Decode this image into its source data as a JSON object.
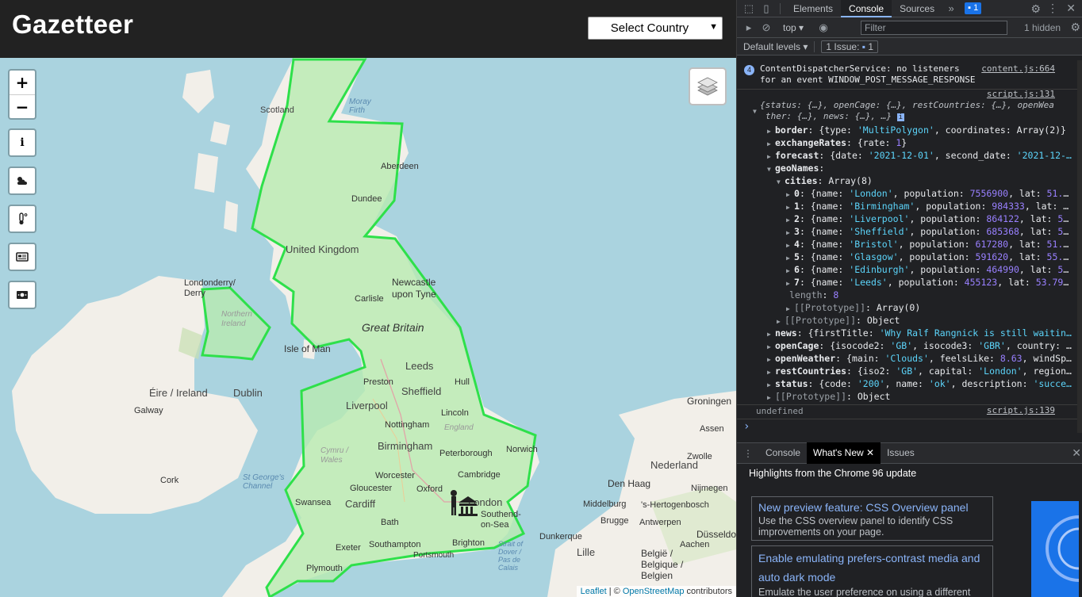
{
  "app": {
    "title": "Gazetteer",
    "country_select": "Select Country"
  },
  "map": {
    "controls": {
      "zoom_in": "+",
      "zoom_out": "−",
      "info": "i"
    },
    "labels": {
      "scotland": "Scotland",
      "moray_firth": "Moray Firth",
      "aberdeen": "Aberdeen",
      "dundee": "Dundee",
      "united_kingdom": "United Kingdom",
      "newcastle": "Newcastle upon Tyne",
      "carlisle": "Carlisle",
      "great_britain": "Great Britain",
      "isle_of_man": "Isle of Man",
      "londonderry": "Londonderry/ Derry",
      "northern_ireland": "Northern Ireland",
      "eire": "Éire / Ireland",
      "dublin": "Dublin",
      "galway": "Galway",
      "cork": "Cork",
      "st_georges": "St George's Channel",
      "leeds": "Leeds",
      "preston": "Preston",
      "shetfield": "Sheffield",
      "hull": "Hull",
      "liverpool": "Liverpool",
      "lincoln": "Lincoln",
      "nottingham": "Nottingham",
      "england": "England",
      "cymru": "Cymru / Wales",
      "birmingham": "Birmingham",
      "peterborough": "Peterborough",
      "norwich": "Norwich",
      "worcester": "Worcester",
      "cambridge": "Cambridge",
      "gloucester": "Gloucester",
      "oxford": "Oxford",
      "swansea": "Swansea",
      "cardiff": "Cardiff",
      "london": "London",
      "southend": "Southend-on-Sea",
      "bath": "Bath",
      "southampton": "Southampton",
      "brighton": "Brighton",
      "exeter": "Exeter",
      "portsmouth": "Portsmouth",
      "plymouth": "Plymouth",
      "groningen": "Groningen",
      "assen": "Assen",
      "zwolle": "Zwolle",
      "nederland": "Nederland",
      "den_haag": "Den Haag",
      "nijmegen": "Nijmegen",
      "middelburg": "Middelburg",
      "hertogenbosch": "'s-Hertogenbosch",
      "brugge": "Brugge",
      "antwerpen": "Antwerpen",
      "duisseldorf": "Düsseldorf",
      "dunkerque": "Dunkerque",
      "lille": "Lille",
      "belgie": "België / Belgique / Belgien",
      "aachen": "Aachen",
      "dover": "Strait of Dover / Pas de Calais"
    },
    "attribution": {
      "leaflet": "Leaflet",
      "sep": " | © ",
      "osm": "OpenStreetMap",
      "contrib": " contributors"
    },
    "colors": {
      "sea": "#aad3df",
      "land": "#f2efe9",
      "border_highlight": "#2ee04a",
      "highlight_fill": "#b8ebb0"
    }
  },
  "devtools": {
    "tabs": [
      "Elements",
      "Console",
      "Sources"
    ],
    "active_tab": "Console",
    "issue_count": "1",
    "context": "top",
    "filter_placeholder": "Filter",
    "hidden": "1 hidden",
    "default_levels": "Default levels",
    "issues_badge": "1 Issue:",
    "issues_badge_count": "1",
    "messages": {
      "warn_count": "4",
      "warn_line1": "ContentDispatcherService: no listeners",
      "warn_line2": "for an event WINDOW_POST_MESSAGE_RESPONSE",
      "warn_src": "content.js:664",
      "log_src": "script.js:131",
      "obj_line1": "{status: {…}, openCage: {…}, restCountries: {…}, openWea",
      "obj_line2": "ther: {…}, news: {…}, …}",
      "undefined": "undefined",
      "undef_src": "script.js:139",
      "prompt": "›"
    },
    "tree": [
      {
        "key": "border",
        "val": "{type: 'MultiPolygon', coordinates: Array(2)}",
        "indent": 0
      },
      {
        "key": "exchangeRates",
        "val": "{rate: 1}",
        "indent": 0
      },
      {
        "key": "forecast",
        "val": "{date: '2021-12-01', second_date: '2021-12-…",
        "indent": 0
      },
      {
        "key": "geoNames",
        "val": "",
        "indent": 0,
        "open": true
      },
      {
        "key": "cities",
        "val": "Array(8)",
        "indent": 1,
        "open": true
      },
      {
        "key": "0",
        "val": "{name: 'London', population: 7556900, lat: 51.…",
        "indent": 2
      },
      {
        "key": "1",
        "val": "{name: 'Birmingham', population: 984333, lat: …",
        "indent": 2
      },
      {
        "key": "2",
        "val": "{name: 'Liverpool', population: 864122, lat: 5…",
        "indent": 2
      },
      {
        "key": "3",
        "val": "{name: 'Sheffield', population: 685368, lat: 5…",
        "indent": 2
      },
      {
        "key": "4",
        "val": "{name: 'Bristol', population: 617280, lat: 51.…",
        "indent": 2
      },
      {
        "key": "5",
        "val": "{name: 'Glasgow', population: 591620, lat: 55.…",
        "indent": 2
      },
      {
        "key": "6",
        "val": "{name: 'Edinburgh', population: 464990, lat: 5…",
        "indent": 2
      },
      {
        "key": "7",
        "val": "{name: 'Leeds', population: 455123, lat: 53.79…",
        "indent": 2
      },
      {
        "key": "length",
        "val": "8",
        "indent": 2,
        "leaf": true
      },
      {
        "key": "[[Prototype]]",
        "val": "Array(0)",
        "indent": 2,
        "plain": true
      },
      {
        "key": "[[Prototype]]",
        "val": "Object",
        "indent": 1,
        "plain": true
      },
      {
        "key": "news",
        "val": "{firstTitle: 'Why Ralf Rangnick is still waitin…",
        "indent": 0
      },
      {
        "key": "openCage",
        "val": "{isocode2: 'GB', isocode3: 'GBR', country: …",
        "indent": 0
      },
      {
        "key": "openWeather",
        "val": "{main: 'Clouds', feelsLike: 8.63, windSp…",
        "indent": 0
      },
      {
        "key": "restCountries",
        "val": "{iso2: 'GB', capital: 'London', region…",
        "indent": 0
      },
      {
        "key": "status",
        "val": "{code: '200', name: 'ok', description: 'succe…",
        "indent": 0
      },
      {
        "key": "[[Prototype]]",
        "val": "Object",
        "indent": 0,
        "plain": true
      }
    ],
    "drawer_tabs": [
      "Console",
      "What's New",
      "Issues"
    ],
    "drawer_active": "What's New",
    "whats_new_heading": "Highlights from the Chrome 96 update",
    "cards": [
      {
        "title": "New preview feature: CSS Overview panel",
        "desc": "Use the CSS overview panel to identify CSS improvements on your page."
      },
      {
        "title": "Enable emulating prefers-contrast media and auto dark mode",
        "desc": "Emulate the user preference on using a different"
      }
    ]
  }
}
